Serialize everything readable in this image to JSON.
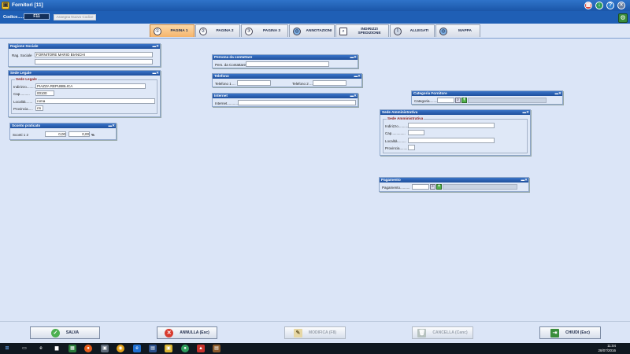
{
  "window": {
    "title": "Fornitori [11]",
    "app_icon": "folder-icon",
    "controls": {
      "calculator": "calculator-icon",
      "download": "download-icon",
      "help": "?",
      "close": "×"
    }
  },
  "codebar": {
    "label": "Codice.......",
    "code_value": "F11",
    "assign_button": "Assegna Nuovo Codice"
  },
  "tabs": [
    {
      "label": "PAGINA 1",
      "icon": "①",
      "active": true
    },
    {
      "label": "PAGINA 2",
      "icon": "②",
      "active": false
    },
    {
      "label": "PAGINA 3",
      "icon": "③",
      "active": false
    },
    {
      "label": "ANNOTAZIONI",
      "icon": "globe-icon",
      "active": false
    },
    {
      "label": "INDIRIZZI SPEDIZIONE",
      "icon": "search-doc-icon",
      "active": false
    },
    {
      "label": "ALLEGATI",
      "icon": "paperclip-icon",
      "active": false
    },
    {
      "label": "MAPPA",
      "icon": "globe-icon",
      "active": false
    }
  ],
  "ragione_sociale": {
    "title": "Ragione Sociale",
    "label": "Rag. Sociale",
    "value": "FORNITORE MARIO BIANCHI",
    "value2": ""
  },
  "sede_legale": {
    "title": "Sede Legale",
    "group_title": "Sede Legale",
    "indirizzo_label": "Indirizzo.........",
    "indirizzo": "PIAZZA REPUBBLICA",
    "cap_label": "Cap..........",
    "cap": "00100",
    "localita_label": "Località.......",
    "localita": "roma",
    "provincia_label": "Provincia.....",
    "provincia": "rm"
  },
  "sconto": {
    "title": "Sconto praticato",
    "label": "Sconti 1 2",
    "value1": "0,00",
    "value2": "0,00",
    "unit": "%"
  },
  "persona": {
    "title": "Persona da contattare",
    "label": "Pers. da Contattare",
    "value": ""
  },
  "telefono": {
    "title": "Telefono",
    "label1": "Telefono 1 ...",
    "value1": "",
    "label2": "Telefono 2 ...",
    "value2": ""
  },
  "internet": {
    "title": "Internet",
    "label": "Internet...........",
    "value": ""
  },
  "categoria": {
    "title": "Categoria Fornitore",
    "label": "Categoria...........",
    "value": ""
  },
  "sede_amm": {
    "title": "Sede Amministrativa",
    "group_title": "Sede Amministrativa",
    "indirizzo_label": "Indirizzo............",
    "cap_label": "Cap..............",
    "localita_label": "Località.........",
    "provincia_label": "Provincia........"
  },
  "pagamento": {
    "title": "Pagamento",
    "label": "Pagamento..........",
    "value": ""
  },
  "buttons": {
    "salva": "SALVA",
    "annulla": "ANNULLA (Esc)",
    "modifica": "MODIFICA (F8)",
    "cancella": "CANCELLA (Canc)",
    "chiudi": "CHIUDI (Esc)"
  },
  "taskbar": {
    "time": "11:04",
    "date": "28/07/2016"
  },
  "colors": {
    "titlebar": "#1b56a8",
    "active_tab": "#f6b56c",
    "panel_header": "#1e4f9c",
    "group_title": "#8a1c1c"
  }
}
